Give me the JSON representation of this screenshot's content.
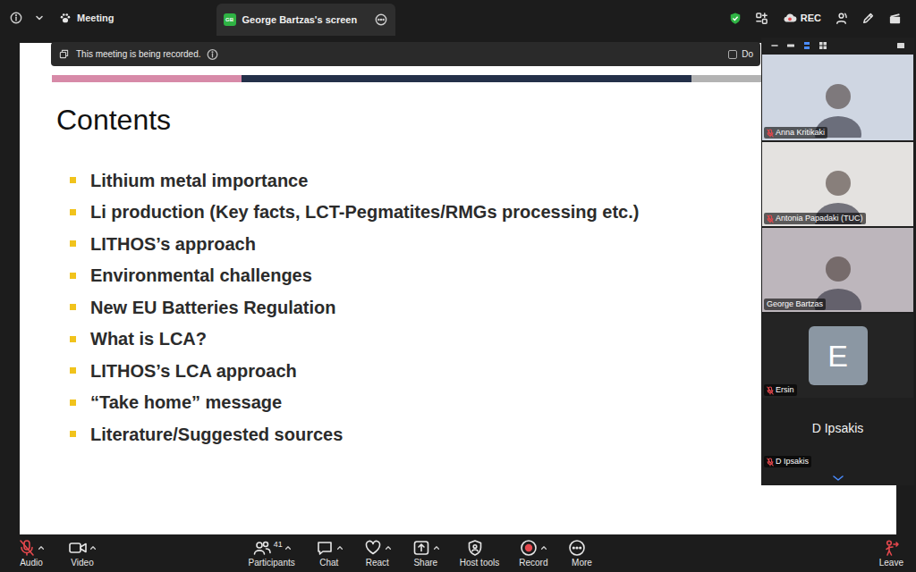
{
  "top_bar": {
    "meeting": "Meeting",
    "share_tab": {
      "initials": "GB",
      "label": "George Bartzas's screen",
      "selected": true
    },
    "rec": "REC"
  },
  "recording_notice": {
    "text": "This meeting is being recorded.",
    "option": "Do",
    "checked": false
  },
  "slide": {
    "title": "Contents",
    "items": [
      "Lithium metal importance",
      "Li production (Key facts, LCT-Pegmatites/RMGs processing etc.)",
      "LITHOS’s approach",
      "Environmental challenges",
      "New EU Batteries Regulation",
      "What is LCA?",
      "LITHOS’s LCA approach",
      "“Take home” message",
      "Literature/Suggested sources"
    ]
  },
  "video_panel": {
    "tiles": [
      {
        "name": "Anna Kritikaki",
        "muted": true,
        "kind": "video"
      },
      {
        "name": "Antonia Papadaki (TUC)",
        "muted": true,
        "kind": "video"
      },
      {
        "name": "George Bartzas",
        "muted": false,
        "kind": "video"
      },
      {
        "name": "Ersin",
        "muted": true,
        "kind": "avatar",
        "initial": "E"
      },
      {
        "name": "D Ipsakis",
        "muted": true,
        "kind": "nameplate",
        "display": "D Ipsakis"
      }
    ]
  },
  "toolbar": {
    "items": [
      {
        "label": "Audio",
        "kind": "audio",
        "muted": true,
        "menu": true
      },
      {
        "label": "Video",
        "kind": "video",
        "menu": true
      },
      {
        "label": "Participants",
        "kind": "participants",
        "count": "41",
        "menu": true
      },
      {
        "label": "Chat",
        "kind": "chat",
        "menu": true
      },
      {
        "label": "React",
        "kind": "react",
        "menu": true
      },
      {
        "label": "Share",
        "kind": "share",
        "menu": true
      },
      {
        "label": "Host tools",
        "kind": "host",
        "menu": false
      },
      {
        "label": "Record",
        "kind": "record",
        "menu": true
      },
      {
        "label": "More",
        "kind": "more",
        "menu": false
      }
    ],
    "leave": {
      "label": "Leave"
    }
  }
}
